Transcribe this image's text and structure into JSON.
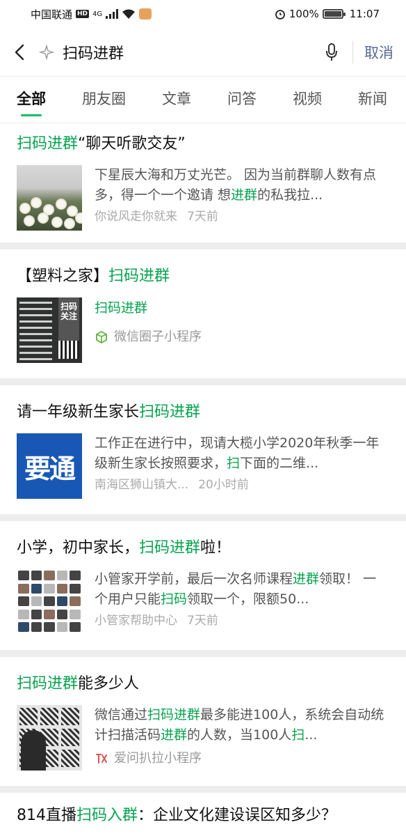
{
  "status_bar": {
    "carrier": "中国联通",
    "hd": "HD",
    "network": "4G",
    "battery": "100%",
    "time": "11:07"
  },
  "search": {
    "query": "扫码进群",
    "cancel_label": "取消"
  },
  "tabs": [
    {
      "label": "全部",
      "active": true
    },
    {
      "label": "朋友圈",
      "active": false
    },
    {
      "label": "文章",
      "active": false
    },
    {
      "label": "问答",
      "active": false
    },
    {
      "label": "视频",
      "active": false
    },
    {
      "label": "新闻",
      "active": false
    }
  ],
  "results": [
    {
      "title_parts": [
        {
          "t": "扫码进群",
          "hl": true
        },
        {
          "t": "“聊天听歌交友”",
          "hl": false
        }
      ],
      "desc_parts": [
        {
          "t": "下星辰大海和万丈光芒。 因为当前群聊人数有点多，得一个一个邀请 想",
          "hl": false
        },
        {
          "t": "进群",
          "hl": true
        },
        {
          "t": "的私我拉...",
          "hl": false
        }
      ],
      "meta": [
        "你说风走你就来",
        "7天前"
      ]
    },
    {
      "title_parts": [
        {
          "t": "【塑料之家】",
          "hl": false
        },
        {
          "t": "扫码进群",
          "hl": true
        }
      ],
      "mini_title": "扫码进群",
      "mini_program": "微信圈子小程序",
      "thumb_text": "扫码关注"
    },
    {
      "title_parts": [
        {
          "t": "请一年级新生家长",
          "hl": false
        },
        {
          "t": "扫码进群",
          "hl": true
        }
      ],
      "desc_parts": [
        {
          "t": "工作正在进行中，现请大榄小学2020年秋季一年级新生家长按照要求，",
          "hl": false
        },
        {
          "t": "扫",
          "hl": true
        },
        {
          "t": "下面的二维...",
          "hl": false
        }
      ],
      "meta": [
        "南海区狮山镇大...",
        "20小时前"
      ],
      "thumb_text": "要通"
    },
    {
      "title_parts": [
        {
          "t": "小学，初中家长，",
          "hl": false
        },
        {
          "t": "扫码进群",
          "hl": true
        },
        {
          "t": "啦！",
          "hl": false
        }
      ],
      "desc_parts": [
        {
          "t": "小管家开学前，最后一次名师课程",
          "hl": false
        },
        {
          "t": "进群",
          "hl": true
        },
        {
          "t": "领取！ 一个用户只能",
          "hl": false
        },
        {
          "t": "扫码",
          "hl": true
        },
        {
          "t": "领取一个，限额50...",
          "hl": false
        }
      ],
      "meta": [
        "小管家帮助中心",
        "7天前"
      ]
    },
    {
      "title_parts": [
        {
          "t": "扫码进群",
          "hl": true
        },
        {
          "t": "能多少人",
          "hl": false
        }
      ],
      "desc_parts": [
        {
          "t": "微信通过",
          "hl": false
        },
        {
          "t": "扫码进群",
          "hl": true
        },
        {
          "t": "最多能进100人，系统会自动统计扫描活码",
          "hl": false
        },
        {
          "t": "进群",
          "hl": true
        },
        {
          "t": "的人数，当100人",
          "hl": false
        },
        {
          "t": "扫",
          "hl": true
        },
        {
          "t": "...",
          "hl": false
        }
      ],
      "mini_program": "爱问扒拉小程序"
    },
    {
      "title_parts": [
        {
          "t": "814直播",
          "hl": false
        },
        {
          "t": "扫码入群",
          "hl": true
        },
        {
          "t": "：企业文化建设误区知多少？",
          "hl": false
        }
      ]
    }
  ]
}
